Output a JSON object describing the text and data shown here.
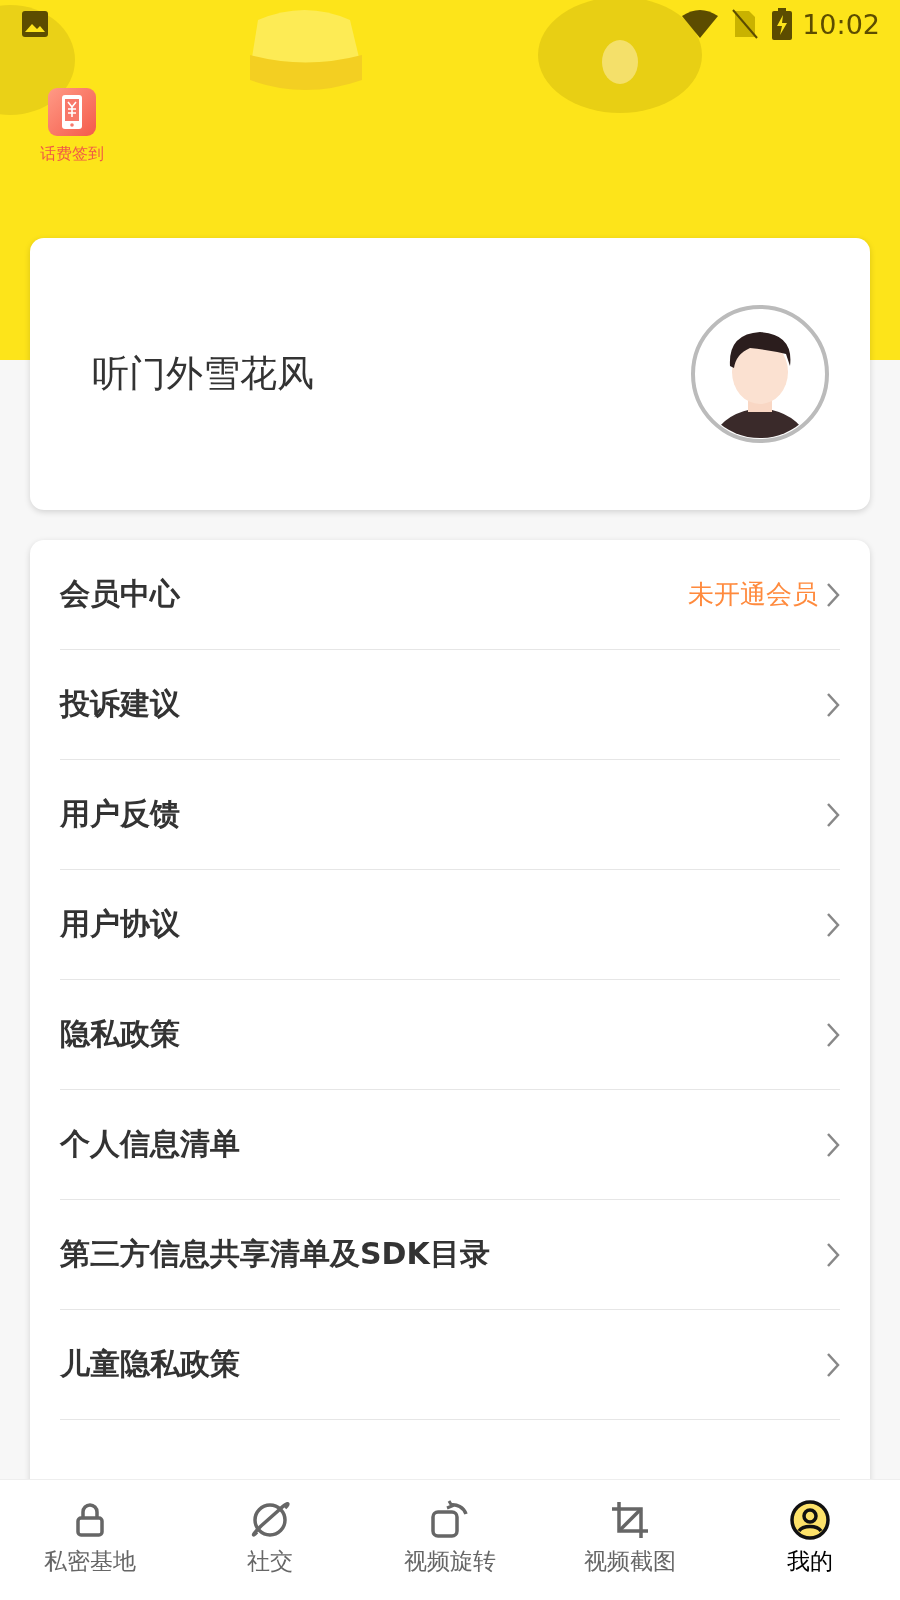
{
  "status_bar": {
    "time": "10:02"
  },
  "header": {
    "kind": "picture",
    "shortcut": {
      "label": "话费签到"
    }
  },
  "profile": {
    "name": "听门外雪花风"
  },
  "menu": [
    {
      "label": "会员中心",
      "value": "未开通会员"
    },
    {
      "label": "投诉建议"
    },
    {
      "label": "用户反馈"
    },
    {
      "label": "用户协议"
    },
    {
      "label": "隐私政策"
    },
    {
      "label": "个人信息清单"
    },
    {
      "label": "第三方信息共享清单及SDK目录"
    },
    {
      "label": "儿童隐私政策"
    }
  ],
  "tab_bar": [
    {
      "label": "私密基地",
      "selected": false
    },
    {
      "label": "社交",
      "selected": false
    },
    {
      "label": "视频旋转",
      "selected": false
    },
    {
      "label": "视频截图",
      "selected": false
    },
    {
      "label": "我的",
      "selected": true
    }
  ]
}
